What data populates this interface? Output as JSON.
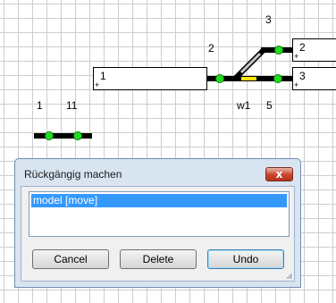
{
  "canvas": {
    "labels": {
      "n3": "3",
      "n2": "2",
      "n1": "1",
      "n11": "11",
      "w1": "w1",
      "n5": "5"
    },
    "boxes": {
      "b1": {
        "plus": "+",
        "text": "1"
      },
      "b2": {
        "plus": "+",
        "text": "2"
      },
      "b3": {
        "plus": "+",
        "text": "3"
      }
    }
  },
  "dialog": {
    "title": "Rückgängig machen",
    "close_symbol": "x",
    "list_items": [
      "model [move]"
    ],
    "buttons": {
      "cancel": "Cancel",
      "delete": "Delete",
      "undo": "Undo"
    }
  }
}
